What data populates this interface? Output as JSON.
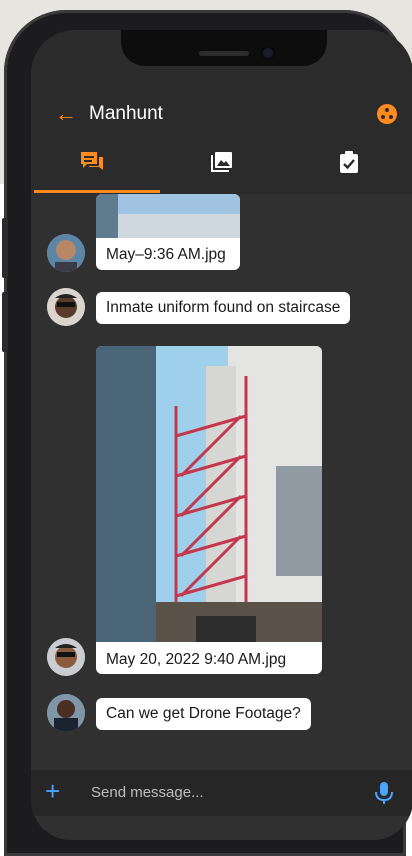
{
  "header": {
    "title": "Manhunt",
    "back_icon": "arrow-left-icon",
    "menu_icon": "group-dots-icon",
    "accent": "#ff8a1e"
  },
  "tabs": [
    {
      "name": "chat",
      "icon": "chat-icon",
      "active": true
    },
    {
      "name": "media",
      "icon": "image-icon",
      "active": false
    },
    {
      "name": "tasks",
      "icon": "clipboard-check-icon",
      "active": false
    }
  ],
  "messages": [
    {
      "type": "image",
      "caption": "May–9:36 AM.jpg"
    },
    {
      "type": "text",
      "text": "Inmate uniform found on staircase"
    },
    {
      "type": "image",
      "caption": "May 20, 2022 9:40 AM.jpg"
    },
    {
      "type": "text",
      "text": "Can we get Drone Footage?"
    }
  ],
  "composer": {
    "placeholder": "Send message...",
    "add_icon": "plus-icon",
    "mic_icon": "microphone-icon"
  }
}
